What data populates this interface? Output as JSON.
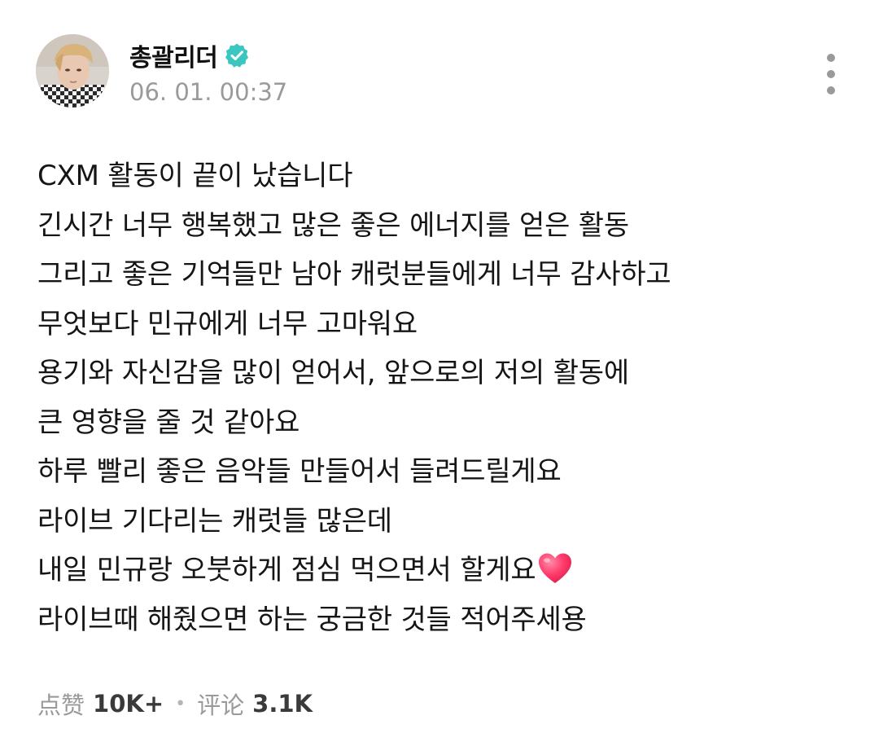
{
  "post": {
    "author": "총괄리더",
    "verified": true,
    "timestamp": "06. 01. 00:37",
    "lines": [
      "CXM 활동이 끝이 났습니다",
      "긴시간 너무 행복했고 많은 좋은 에너지를 얻은 활동",
      "그리고 좋은 기억들만 남아 캐럿분들에게 너무 감사하고",
      "무엇보다 민규에게 너무 고마워요",
      "용기와 자신감을 많이 얻어서, 앞으로의 저의 활동에",
      "큰 영향을 줄 것 같아요",
      "하루 빨리 좋은 음악들 만들어서 들려드릴게요",
      "라이브 기다리는 캐럿들 많은데",
      "내일 민규랑 오붓하게 점심 먹으면서 할게요",
      "라이브때 해줬으면 하는 궁금한 것들 적어주세용"
    ],
    "emoji": "heart-emoji"
  },
  "stats": {
    "likes_label": "点赞",
    "likes_count": "10K+",
    "separator": "•",
    "comments_label": "评论",
    "comments_count": "3.1K"
  },
  "colors": {
    "verified_badge": "#3cc6c0",
    "timestamp": "#9a9a9a",
    "heart": "#ff3b6b"
  },
  "icons": [
    "avatar",
    "verified-badge-icon",
    "more-options-icon",
    "heart-emoji"
  ]
}
